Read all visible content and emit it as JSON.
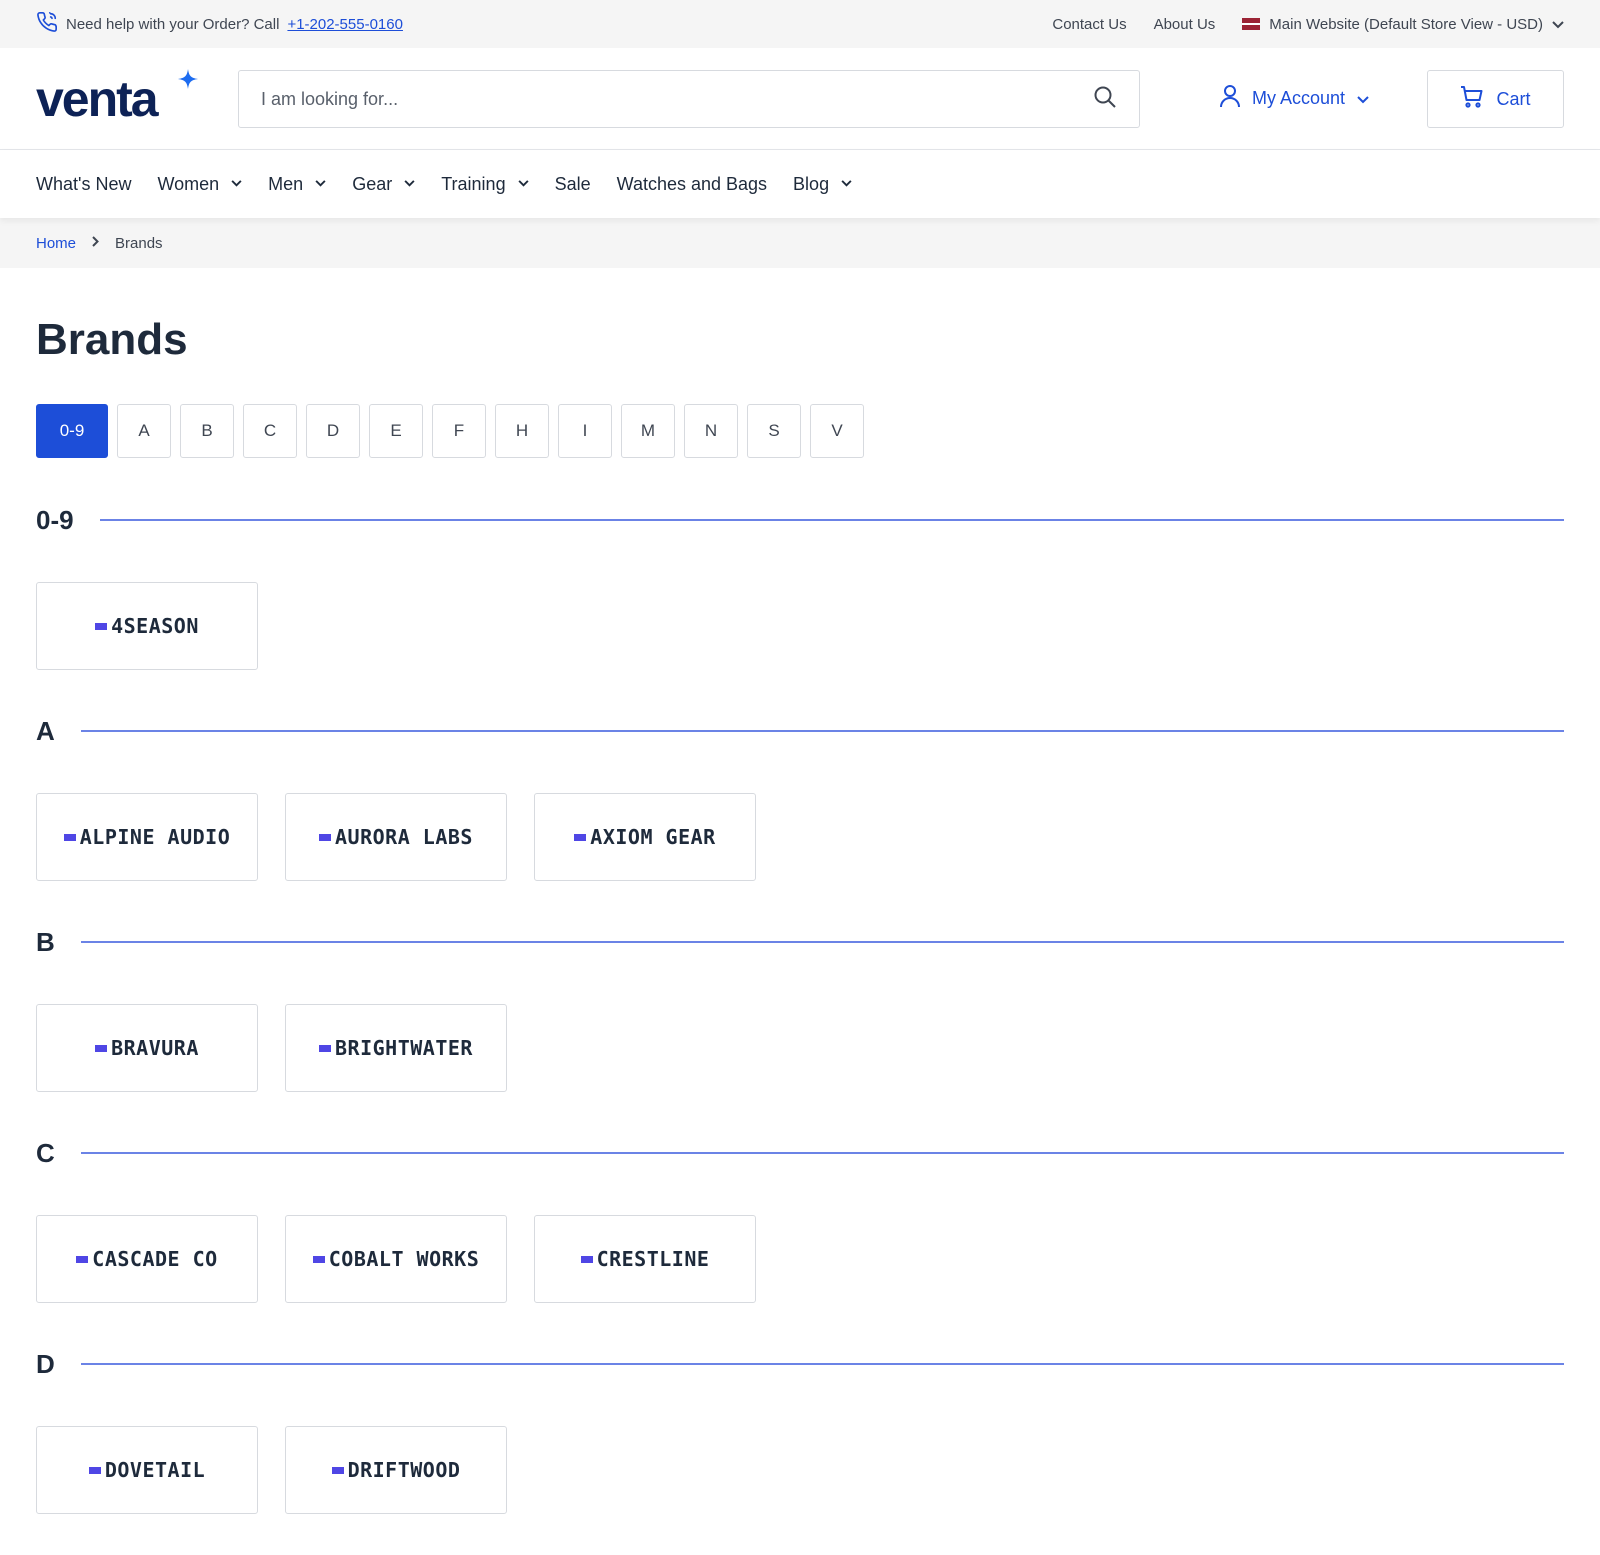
{
  "topbar": {
    "help_text": "Need help with your Order? Call",
    "phone": "+1-202-555-0160",
    "contact": "Contact Us",
    "about": "About Us",
    "store": "Main Website (Default Store View - USD)",
    "phone_icon": "phone-icon"
  },
  "header": {
    "logo": "venta",
    "search_placeholder": "I am looking for...",
    "account": "My Account",
    "cart": "Cart"
  },
  "nav": [
    {
      "label": "What's New",
      "dropdown": false
    },
    {
      "label": "Women",
      "dropdown": true
    },
    {
      "label": "Men",
      "dropdown": true
    },
    {
      "label": "Gear",
      "dropdown": true
    },
    {
      "label": "Training",
      "dropdown": true
    },
    {
      "label": "Sale",
      "dropdown": false
    },
    {
      "label": "Watches and Bags",
      "dropdown": false
    },
    {
      "label": "Blog",
      "dropdown": true
    }
  ],
  "breadcrumb": {
    "home": "Home",
    "current": "Brands"
  },
  "page_title": "Brands",
  "letters": [
    "0-9",
    "A",
    "B",
    "C",
    "D",
    "E",
    "F",
    "H",
    "I",
    "M",
    "N",
    "S",
    "V"
  ],
  "active_letter": "0-9",
  "sections": [
    {
      "label": "0-9",
      "brands": [
        "4SEASON"
      ]
    },
    {
      "label": "A",
      "brands": [
        "ALPINE AUDIO",
        "AURORA LABS",
        "AXIOM GEAR"
      ]
    },
    {
      "label": "B",
      "brands": [
        "BRAVURA",
        "BRIGHTWATER"
      ]
    },
    {
      "label": "C",
      "brands": [
        "CASCADE CO",
        "COBALT WORKS",
        "CRESTLINE"
      ]
    },
    {
      "label": "D",
      "brands": [
        "DOVETAIL",
        "DRIFTWOOD"
      ]
    }
  ],
  "colors": {
    "accent": "#1d4ed8",
    "brand_mark": "#4f46e5",
    "divider": "#6b83e6"
  }
}
